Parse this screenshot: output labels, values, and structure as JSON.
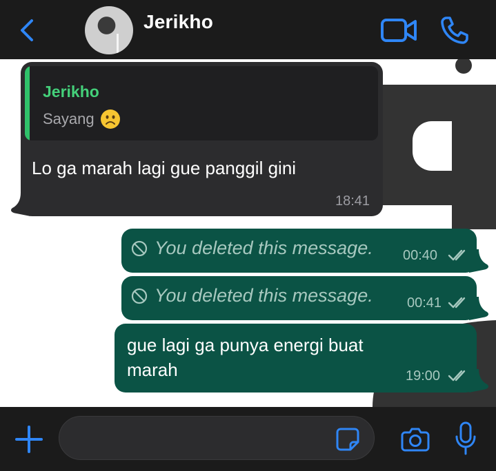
{
  "header": {
    "contact_name": "Jerikho"
  },
  "messages": [
    {
      "direction": "incoming",
      "quote": {
        "author": "Jerikho",
        "text": "Sayang",
        "emoji": "frowning-face"
      },
      "text": "Lo ga marah lagi gue panggil gini",
      "time": "18:41"
    },
    {
      "direction": "outgoing",
      "deleted": true,
      "text": "You deleted this message.",
      "time": "00:40"
    },
    {
      "direction": "outgoing",
      "deleted": true,
      "text": "You deleted this message.",
      "time": "00:41"
    },
    {
      "direction": "outgoing",
      "text_line1": "gue lagi ga punya energi buat",
      "text_line2": "marah",
      "time": "19:00"
    }
  ],
  "composer": {
    "value": "",
    "placeholder": ""
  },
  "colors": {
    "bar_background": "#1b1b1b",
    "incoming_bubble": "#2c2c2e",
    "outgoing_bubble": "#0b5345",
    "accent_blue": "#2f86f6",
    "quote_author_green": "#44d07a"
  },
  "icons": [
    "back-chevron-icon",
    "video-camera-icon",
    "phone-icon",
    "prohibited-icon",
    "double-check-icon",
    "plus-icon",
    "sticker-icon",
    "camera-icon",
    "microphone-icon"
  ]
}
